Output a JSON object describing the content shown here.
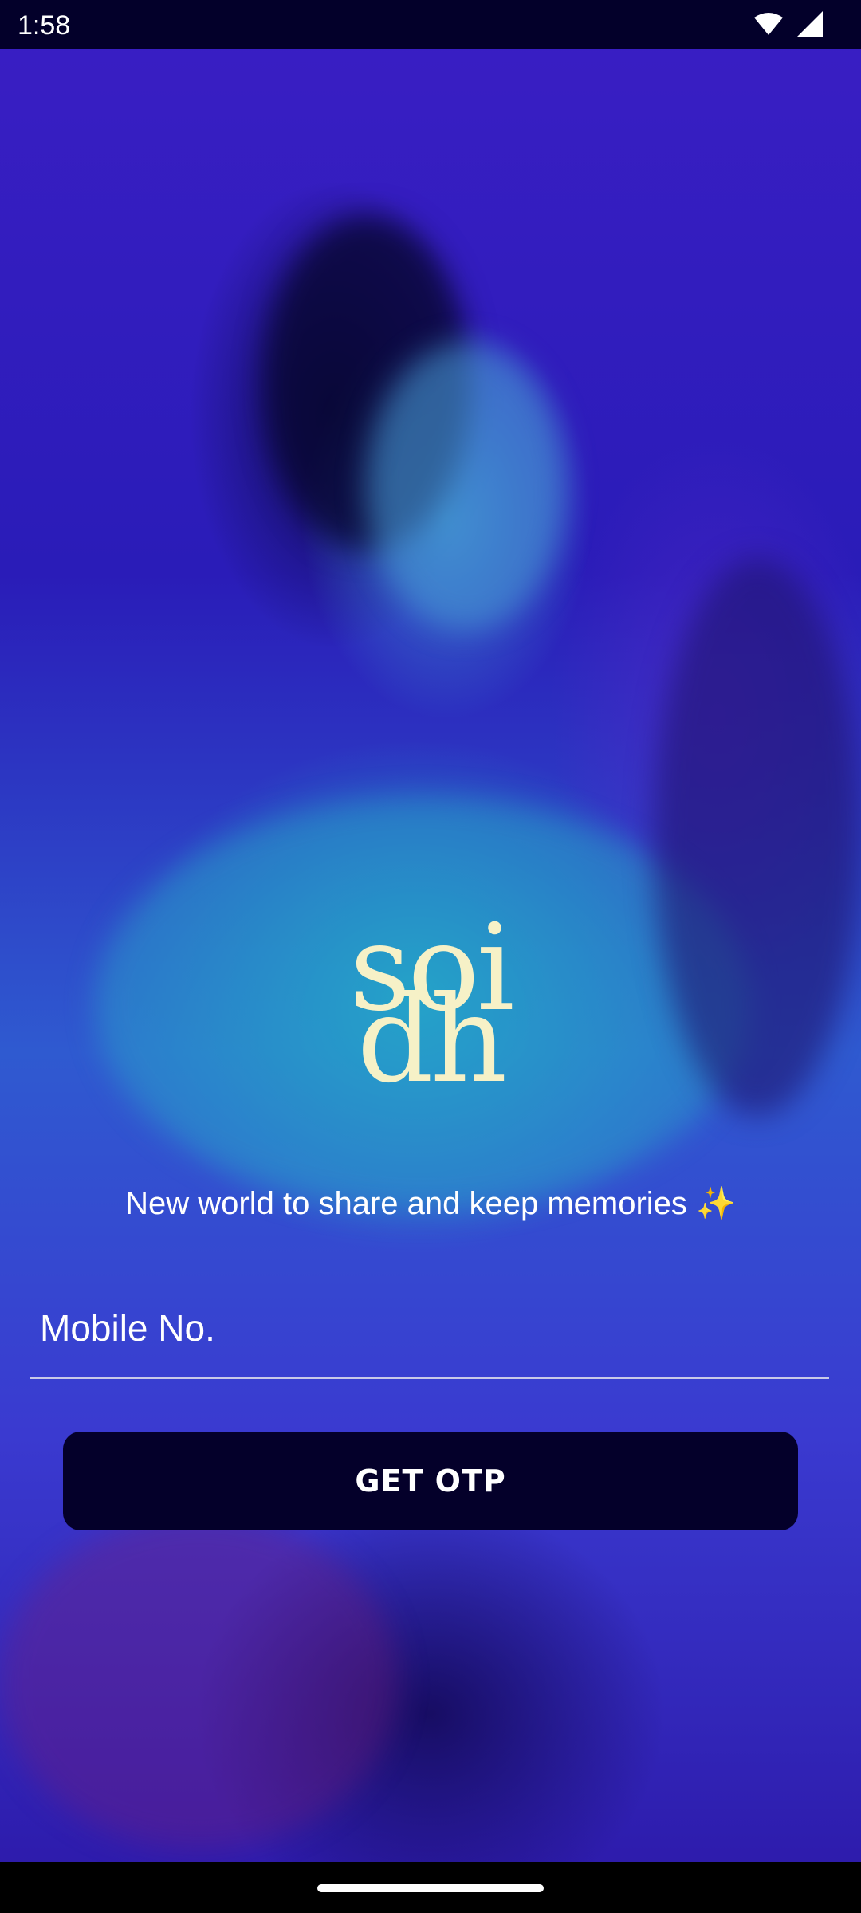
{
  "status_bar": {
    "time": "1:58",
    "icons": [
      "wifi-icon",
      "signal-icon"
    ]
  },
  "logo": {
    "line1": "soi",
    "line2": "dh",
    "color": "#f6f1c7"
  },
  "tagline": "New world to share and keep memories ✨",
  "form": {
    "mobile_placeholder": "Mobile No.",
    "mobile_value": "",
    "submit_label": "GET OTP"
  },
  "colors": {
    "button_bg": "#04002a",
    "status_bar_bg": "#03002a",
    "text": "#ffffff"
  }
}
